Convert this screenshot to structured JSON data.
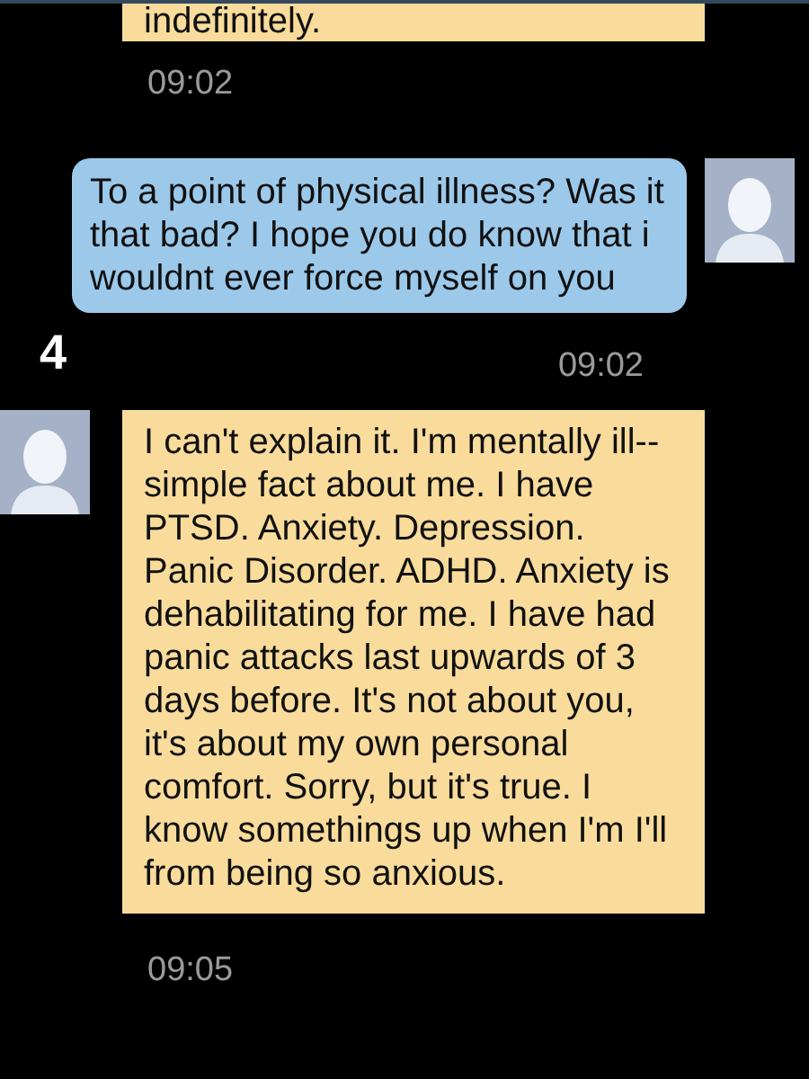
{
  "messages": [
    {
      "kind": "incoming",
      "text": "indefinitely.",
      "time": "09:02",
      "avatar": false
    },
    {
      "kind": "outgoing",
      "text": "To a point of physical illness? Was it that bad?  I hope you do know that i wouldnt ever force myself on you",
      "time": "09:02",
      "avatar": true,
      "marker": "4"
    },
    {
      "kind": "incoming",
      "text": "I can't explain it. I'm mentally ill--simple fact about me. I have PTSD. Anxiety. Depression. Panic Disorder. ADHD. Anxiety is dehabilitating for me. I have had panic attacks last upwards of 3 days before. It's not about you, it's about my own personal comfort. Sorry, but it's true. I know somethings up when I'm I'll from being so anxious.",
      "time": "09:05",
      "avatar": true
    }
  ]
}
